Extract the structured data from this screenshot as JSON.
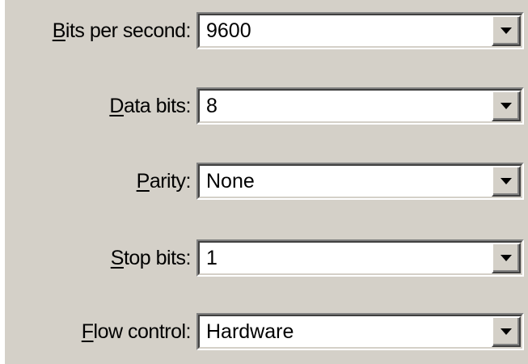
{
  "fields": [
    {
      "label_mnemonic": "B",
      "label_rest": "its per second:",
      "value": "9600",
      "icon": "chevron-down-icon"
    },
    {
      "label_mnemonic": "D",
      "label_rest": "ata bits:",
      "value": "8",
      "icon": "chevron-down-icon"
    },
    {
      "label_mnemonic": "P",
      "label_rest": "arity:",
      "value": "None",
      "icon": "chevron-down-icon"
    },
    {
      "label_mnemonic": "S",
      "label_rest": "top bits:",
      "value": "1",
      "icon": "chevron-down-icon"
    },
    {
      "label_mnemonic": "F",
      "label_rest": "low control:",
      "value": "Hardware",
      "icon": "chevron-down-icon"
    }
  ],
  "colors": {
    "dialog_background": "#d4d0c8",
    "field_background": "#ffffff",
    "text": "#000000"
  }
}
